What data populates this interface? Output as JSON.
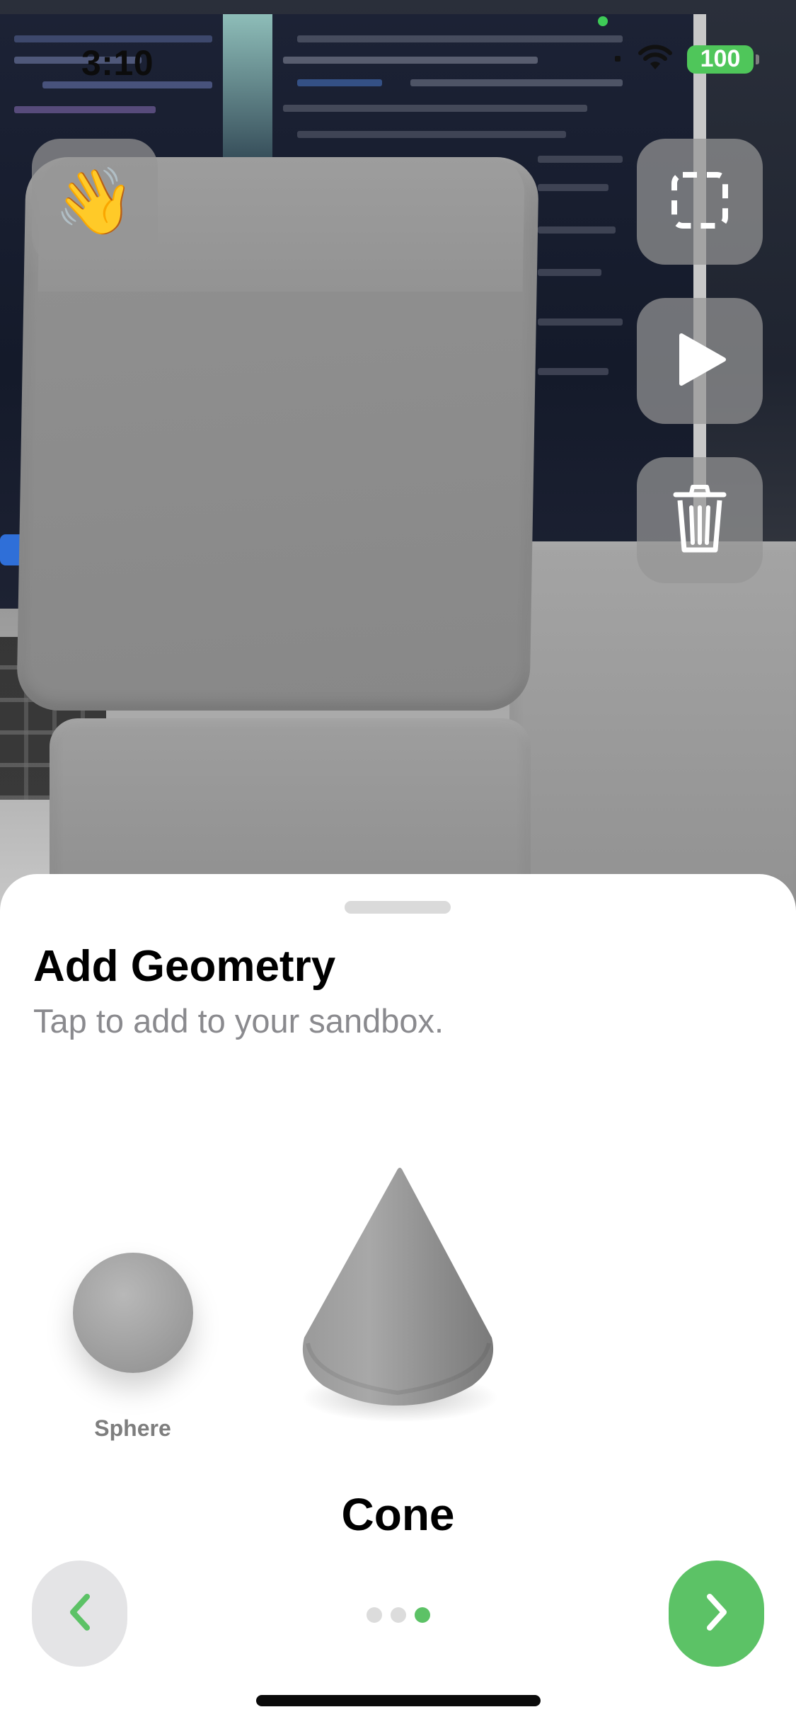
{
  "status_bar": {
    "time": "3:10",
    "battery": "100"
  },
  "ar_toolbar": {
    "wave_emoji": "👋",
    "select_icon": "dashed-square-icon",
    "play_icon": "play-icon",
    "delete_icon": "trash-icon"
  },
  "sheet": {
    "title": "Add Geometry",
    "subtitle": "Tap to add to your sandbox.",
    "shapes": [
      {
        "name": "Sphere",
        "selected": false
      },
      {
        "name": "Cone",
        "selected": true
      }
    ],
    "selected_label": "Cone",
    "page_count": 3,
    "current_page": 3
  },
  "colors": {
    "accent": "#5cc266",
    "battery": "#4fc65a"
  }
}
